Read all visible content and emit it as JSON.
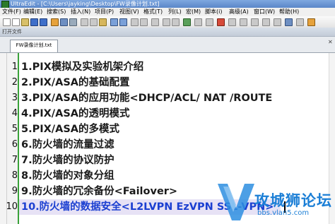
{
  "window": {
    "title": "UltraEdit - [C:\\Users\\jayking\\Desktop\\FW录像计划.txt]"
  },
  "menubar": {
    "items": [
      "文件(F)",
      "编辑(E)",
      "搜索(S)",
      "插入(N)",
      "项目(P)",
      "视图(V)",
      "格式(T)",
      "列(L)",
      "宏(M)",
      "脚本(i)",
      "高级(A)",
      "窗口(W)",
      "帮助(H)"
    ]
  },
  "panel": {
    "label": "打开文件"
  },
  "tabs": [
    {
      "label": "FW录像计划.txt"
    }
  ],
  "editor": {
    "lines": [
      {
        "num": "1",
        "text": "1.PIX模拟及实验机架介绍"
      },
      {
        "num": "2",
        "text": "2.PIX/ASA的基础配置"
      },
      {
        "num": "3",
        "text": "3.PIX/ASA的应用功能<DHCP/ACL/ NAT /ROUTE"
      },
      {
        "num": "4",
        "text": "4.PIX/ASA的透明模式"
      },
      {
        "num": "5",
        "text": "5.PIX/ASA的多模式"
      },
      {
        "num": "6",
        "text": "6.防火墙的流量过滤"
      },
      {
        "num": "7",
        "text": "7.防火墙的协议防护"
      },
      {
        "num": "8",
        "text": "8.防火墙的对象分组"
      },
      {
        "num": "9",
        "text": "9.防火墙的冗余备份<Failover>"
      },
      {
        "num": "10",
        "text": "10.防火墙的数据安全<L2LVPN EzVPN SSL-VPN>"
      }
    ],
    "active_line": 10,
    "active_color": "#1b3fd1"
  },
  "watermark": {
    "text": "攻城狮论坛",
    "url": "bbs.vlan5.com"
  },
  "colors": {
    "titlebar": "#5a86c9",
    "gutter_border": "#3aa23a"
  }
}
